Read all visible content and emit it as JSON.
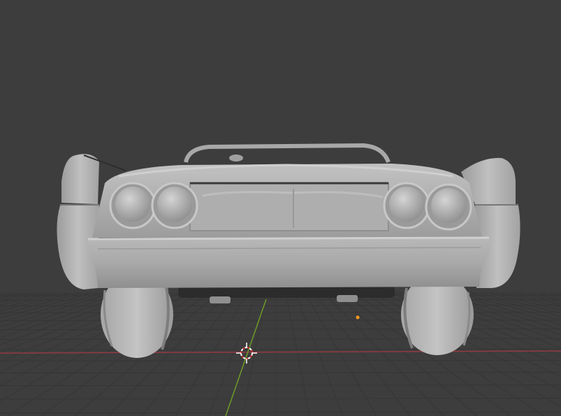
{
  "viewport": {
    "view": "front",
    "shading": "solid",
    "background_color": "#3d3d3d",
    "grid_color": "#363636",
    "x_axis_color": "#b03a44",
    "y_axis_color": "#6e9b2a",
    "origin_color": "#ff9a1f",
    "model_color": "#b8b8b8"
  },
  "scene": {
    "objects": [
      {
        "name": "car-body",
        "icon": "mesh"
      },
      {
        "name": "3d-cursor",
        "icon": "crosshair"
      },
      {
        "name": "object-origin",
        "icon": "dot"
      }
    ]
  }
}
